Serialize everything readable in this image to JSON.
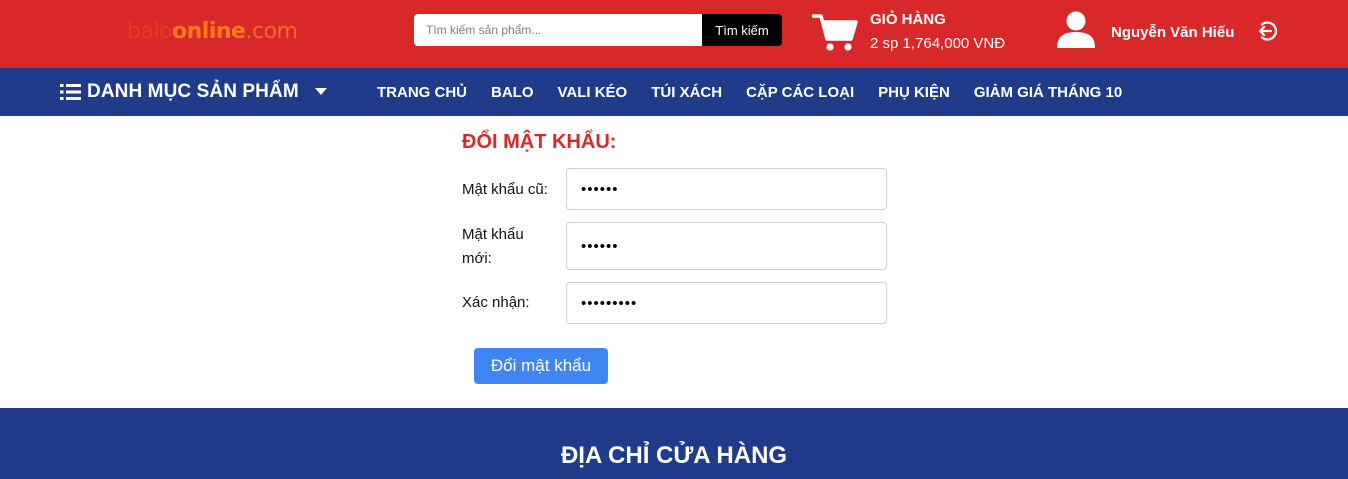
{
  "header": {
    "logo": {
      "part1": "balo",
      "part2": "online",
      "part3": ".com"
    },
    "search": {
      "placeholder": "Tìm kiếm sản phẩm...",
      "value": "",
      "button_label": "Tìm kiếm"
    },
    "cart": {
      "title": "GIỎ HÀNG",
      "summary": "2 sp 1,764,000 VNĐ",
      "icon": "cart-icon"
    },
    "user": {
      "name": "Nguyễn Văn Hiếu",
      "icon": "user-icon",
      "logout_icon": "logout-icon"
    },
    "colors": {
      "background": "#d9282a",
      "search_button": "#000000"
    }
  },
  "nav": {
    "category_label": "DANH MỤC SẢN PHẨM",
    "category_icon": "list-icon",
    "category_caret": "caret-down-icon",
    "items": [
      {
        "label": "TRANG CHỦ"
      },
      {
        "label": "BALO"
      },
      {
        "label": "VALI KÉO"
      },
      {
        "label": "TÚI XÁCH"
      },
      {
        "label": "CẶP CÁC LOẠI"
      },
      {
        "label": "PHỤ KIỆN"
      },
      {
        "label": "GIẢM GIÁ THÁNG 10"
      }
    ],
    "colors": {
      "background": "#1f3b8a"
    }
  },
  "form": {
    "title": "ĐỔI MẬT KHẨU:",
    "fields": [
      {
        "label": "Mật khẩu cũ:",
        "value": "••••••"
      },
      {
        "label_line1": "Mật khẩu",
        "label_line2": "mới:",
        "value": "••••••"
      },
      {
        "label": "Xác nhận:",
        "value": "•••••••••"
      }
    ],
    "submit_label": "Đổi mật khẩu",
    "colors": {
      "title": "#d9282a",
      "button": "#3f86f2"
    }
  },
  "footer": {
    "title": "ĐỊA CHỈ CỬA HÀNG",
    "colors": {
      "background": "#1f3b8a"
    }
  }
}
